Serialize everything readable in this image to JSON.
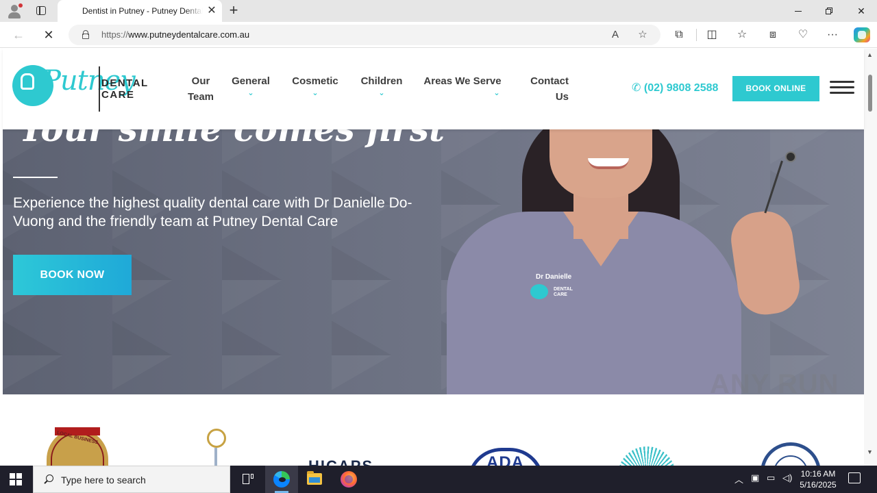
{
  "browser": {
    "tab_title": "Dentist in Putney - Putney Dental Care",
    "tab_close": "✕",
    "new_tab": "+",
    "url_protocol": "https://",
    "url_host": "www.putneydentalcare.com.au",
    "window": {
      "minimize": "",
      "maximize": "",
      "close": "✕"
    },
    "icons": {
      "back": "←",
      "stop": "✕",
      "read_aloud": "A",
      "favorite": "☆",
      "extensions": "⧉",
      "split": "◫",
      "favorites": "☆",
      "collections": "⧈",
      "performance": "♡",
      "menu": "···"
    }
  },
  "site": {
    "logo_script": "Putney",
    "logo_line1": "DENTAL",
    "logo_line2": "CARE",
    "nav": [
      {
        "label_line1": "Our",
        "label_line2": "Team",
        "has_dropdown": false
      },
      {
        "label_line1": "General",
        "label_line2": "",
        "has_dropdown": true
      },
      {
        "label_line1": "Cosmetic",
        "label_line2": "",
        "has_dropdown": true
      },
      {
        "label_line1": "Children",
        "label_line2": "",
        "has_dropdown": true
      },
      {
        "label_line1": "Areas We Serve",
        "label_line2": "",
        "has_dropdown": true
      },
      {
        "label_line1": "Contact",
        "label_line2": "Us",
        "has_dropdown": false
      }
    ],
    "chevron": "⌄",
    "phone_icon": "✆",
    "phone": "(02) 9808 2588",
    "book_online": "BOOK ONLINE",
    "accent_color": "#2ec9d0"
  },
  "hero": {
    "title": "Your smile comes first",
    "subtitle": "Experience the highest quality dental care with Dr Danielle Do-Vuong and the friendly team at Putney Dental Care",
    "cta": "BOOK NOW",
    "badge_name": "Dr Danielle",
    "badge_line1": "DENTAL",
    "badge_line2": "CARE"
  },
  "logos": {
    "local_business": "LOCAL BUSINESS",
    "hicaps": "HICAPS",
    "ada": "ADA"
  },
  "watermark": "ANY RUN",
  "taskbar": {
    "search_placeholder": "Type here to search",
    "time": "10:16 AM",
    "date": "5/16/2025",
    "tray_chevron": "︿"
  }
}
